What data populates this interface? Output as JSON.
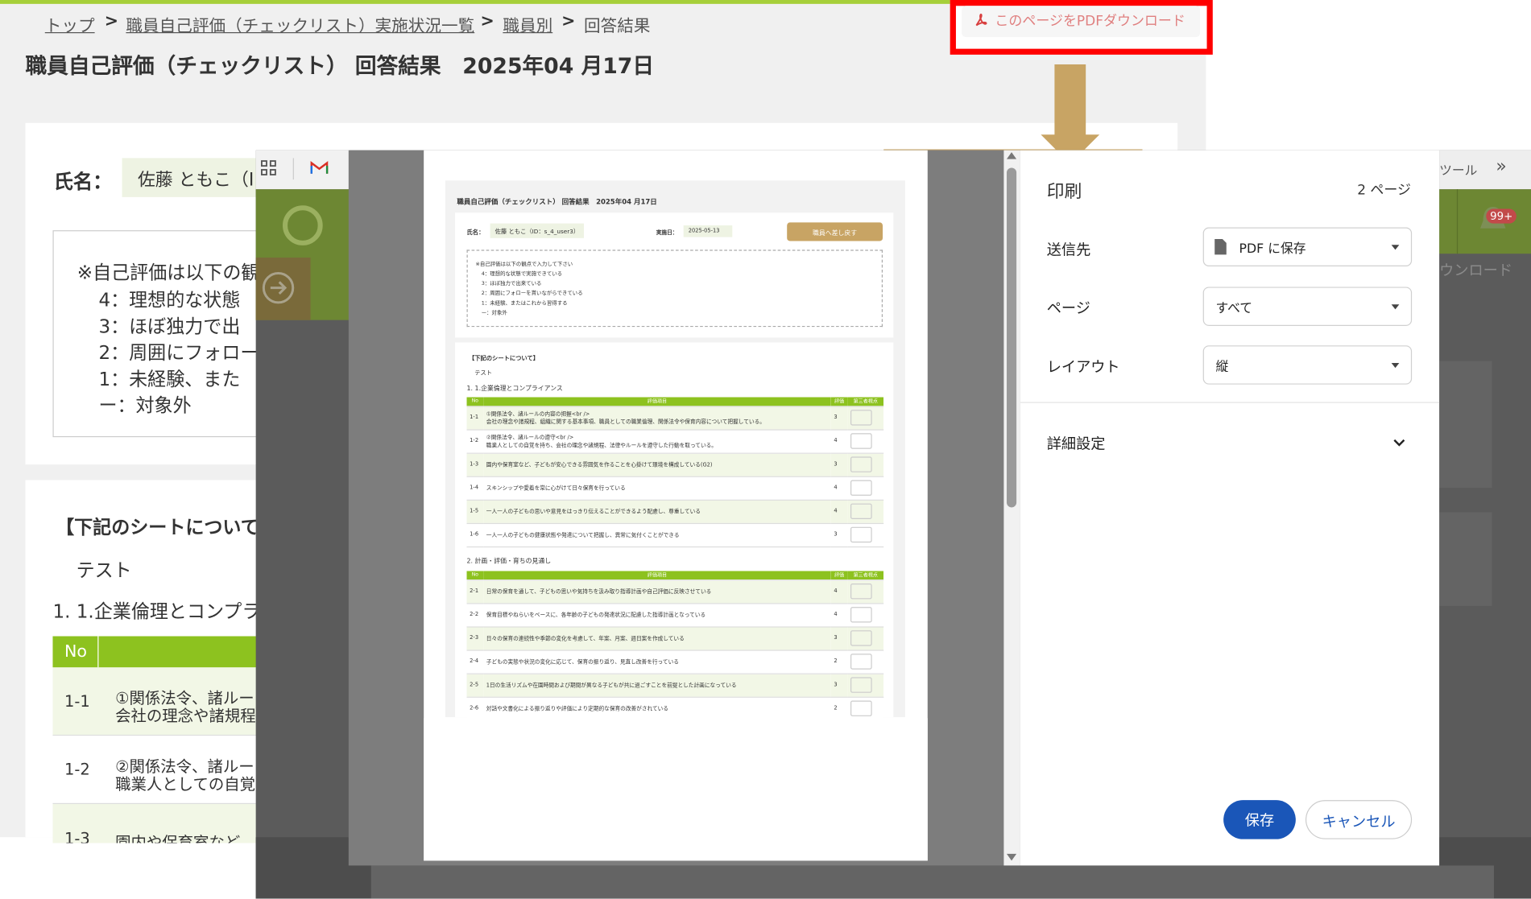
{
  "breadcrumb": {
    "top": "トップ",
    "list": "職員自己評価（チェックリスト）実施状況一覧",
    "by_staff": "職員別",
    "current": "回答結果",
    "sep": ">"
  },
  "page_title": "職員自己評価（チェックリスト） 回答結果　2025年04 月17日",
  "pdf_button": "このページをPDFダウンロード",
  "background": {
    "name_label": "氏名：",
    "name_value": "佐藤 ともこ（I",
    "notes": [
      "※自己評価は以下の観",
      "4：理想的な状態",
      "3：ほぼ独力で出",
      "2：周囲にフォロー",
      "1：未経験、また",
      "ー：対象外"
    ],
    "sheet_heading": "【下記のシートについて",
    "test": "テスト",
    "section1": "1. 1.企業倫理とコンプラ",
    "table_header_no": "No",
    "rows": [
      {
        "no": "1-1",
        "line1": "①関係法令、諸ルー",
        "line2": "会社の理念や諸規程"
      },
      {
        "no": "1-2",
        "line1": "②関係法令、諸ルー",
        "line2": "職業人としての自覚"
      },
      {
        "no": "1-3",
        "line1": "園内や保育室など、",
        "line2": ""
      }
    ]
  },
  "browser_right": {
    "tools": "ツール",
    "chevrons": "»",
    "badge": "99+",
    "download_partial": "ウンロード"
  },
  "preview": {
    "title": "職員自己評価（チェックリスト） 回答結果　2025年04 月17日",
    "name_label": "氏名：",
    "name_value": "佐藤 ともこ（ID：s_4_user3）",
    "date_label": "実施日：",
    "date_value": "2025-05-13",
    "back_button": "職員へ差し戻す",
    "notes": [
      "※自己評価は以下の観点で入力して下さい",
      "4：理想的な状態で実施できている",
      "3：ほぼ独力で出来ている",
      "2：周囲にフォローを貰いながらできている",
      "1：未経験、またはこれから習得する",
      "ー：対象外"
    ],
    "sheet_heading": "【下記のシートについて】",
    "test": "テスト",
    "section1": "1. 1.企業倫理とコンプライアンス",
    "section2": "2. 計画・評価・育ちの見通し",
    "col_no": "No",
    "col_item": "評価項目",
    "col_score": "評価",
    "col_third": "第三者視点",
    "table1": [
      {
        "no": "1-1",
        "text": "①関係法令、諸ルールの内容の把握<br />",
        "text2": "会社の理念や諸規程、組織に関する基本事項、職員としての職業倫理、関係法令や保育内容について把握している。",
        "score": "3"
      },
      {
        "no": "1-2",
        "text": "②関係法令、諸ルールの遵守<br />",
        "text2": "職業人としての自覚を持ち、会社の理念や諸規程、法律やルールを遵守した行動を取っている。",
        "score": "4"
      },
      {
        "no": "1-3",
        "text": "園内や保育室など、子どもが安心できる雰囲気を作ることを心掛けて環境を構成している(G2)",
        "text2": "",
        "score": "3"
      },
      {
        "no": "1-4",
        "text": "スキンシップや愛着を常に心がけて日々保育を行っている",
        "text2": "",
        "score": "4"
      },
      {
        "no": "1-5",
        "text": "一人一人の子どもの思いや意見をはっきり伝えることができるよう配慮し、尊重している",
        "text2": "",
        "score": "4"
      },
      {
        "no": "1-6",
        "text": "一人一人の子どもの健康状態や発達について把握し、異常に気付くことができる",
        "text2": "",
        "score": "3"
      }
    ],
    "table2": [
      {
        "no": "2-1",
        "text": "日常の保育を通して、子どもの思いや気持ちを汲み取り指導計画や自己評価に反映させている",
        "score": "4"
      },
      {
        "no": "2-2",
        "text": "保育目標やねらいをベースに、各年齢の子どもの発達状況に配慮した指導計画となっている",
        "score": "4"
      },
      {
        "no": "2-3",
        "text": "日々の保育の連続性や季節の変化を考慮して、年案、月案、週日案を作成している",
        "score": "3"
      },
      {
        "no": "2-4",
        "text": "子どもの実態や状況の変化に応じて、保育の振り返り、見直し改善を行っている",
        "score": "2"
      },
      {
        "no": "2-5",
        "text": "1日の生活リズムや在園時間および期間が異なる子どもが共に過ごすことを前提とした計画になっている",
        "score": "3"
      },
      {
        "no": "2-6",
        "text": "対話や文書化による振り返りや評価により定期的な保育の改善がされている",
        "score": "2"
      }
    ]
  },
  "print_panel": {
    "title": "印刷",
    "pages_count": "2 ページ",
    "dest_label": "送信先",
    "dest_value": "PDF に保存",
    "page_label": "ページ",
    "page_value": "すべて",
    "layout_label": "レイアウト",
    "layout_value": "縦",
    "more_label": "詳細設定",
    "save_button": "保存",
    "cancel_button": "キャンセル"
  },
  "colors": {
    "accent_green": "#8dc21f",
    "brown": "#c8a464",
    "highlight_red": "#ff0000",
    "save_blue": "#1a56b8"
  }
}
